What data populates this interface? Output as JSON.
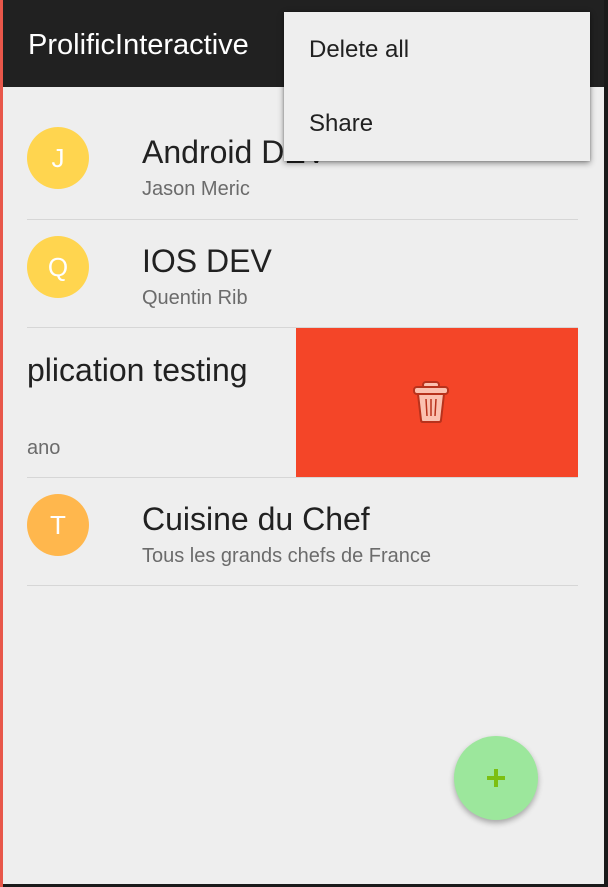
{
  "app": {
    "title": "ProlificInteractive"
  },
  "menu": {
    "items": [
      {
        "label": "Delete all"
      },
      {
        "label": "Share"
      }
    ]
  },
  "list": {
    "items": [
      {
        "initial": "J",
        "title": "Android DEV",
        "subtitle": "Jason Meric",
        "avatar_color": "#ffd54f"
      },
      {
        "initial": "Q",
        "title": "IOS DEV",
        "subtitle": "Quentin Rib",
        "avatar_color": "#ffd54f"
      },
      {
        "title": "plication testing",
        "subtitle": "ano",
        "state": "swiped-to-delete"
      },
      {
        "initial": "T",
        "title": "Cuisine du Chef",
        "subtitle": "Tous les grands chefs de France",
        "avatar_color": "#ffb74d"
      }
    ]
  },
  "swipe_action": {
    "icon": "trash-icon",
    "color": "#f44528"
  },
  "fab": {
    "icon": "add-icon",
    "color": "#9ce79c"
  },
  "colors": {
    "appbar": "#212121",
    "background": "#eeeeee",
    "accent_plus": "#7cbf12"
  }
}
